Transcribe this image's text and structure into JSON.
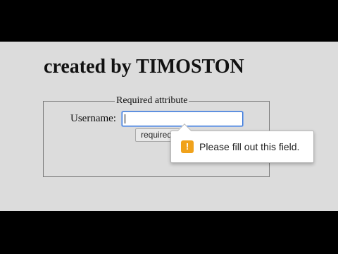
{
  "page": {
    "title": "created by TIMOSTON"
  },
  "form": {
    "legend": "Required attribute",
    "username_label": "Username:",
    "username_value": "",
    "submit_label": "required"
  },
  "validation_tooltip": {
    "icon": "warning-icon",
    "icon_glyph": "!",
    "message": "Please fill out this field."
  },
  "colors": {
    "page_background": "#dcdcdc",
    "letterbox": "#000000",
    "input_focus_border": "#3b78d8",
    "warning_icon": "#f0a21b"
  }
}
